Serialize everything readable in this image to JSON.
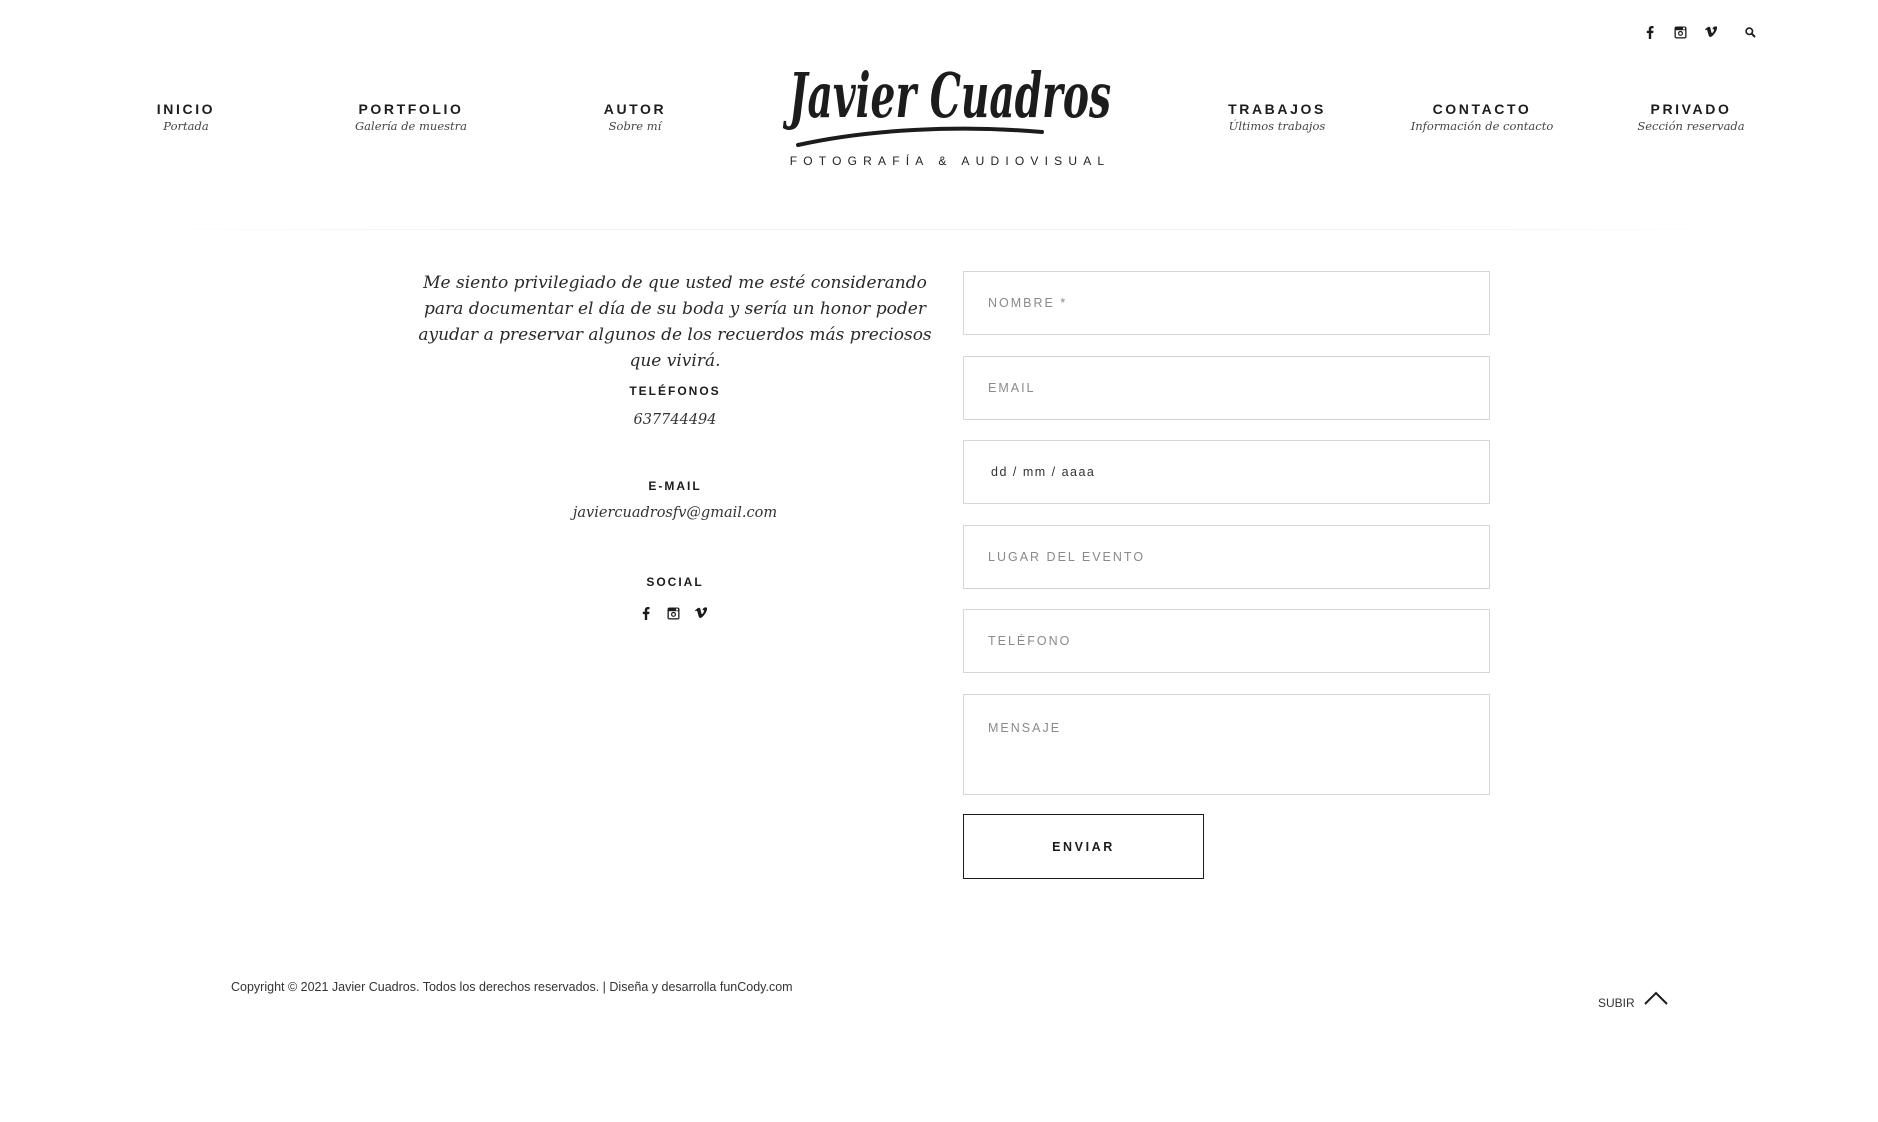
{
  "top_icons": [
    "facebook-icon",
    "instagram-icon",
    "vimeo-icon",
    "search-icon"
  ],
  "logo": {
    "script_text": "Javier Cuadros",
    "tagline": "FOTOGRAFÍA & AUDIOVISUAL"
  },
  "nav": {
    "left": [
      {
        "label": "INICIO",
        "sub": "Portada"
      },
      {
        "label": "PORTFOLIO",
        "sub": "Galería de muestra"
      },
      {
        "label": "AUTOR",
        "sub": "Sobre mí"
      }
    ],
    "right": [
      {
        "label": "TRABAJOS",
        "sub": "Últimos trabajos"
      },
      {
        "label": "CONTACTO",
        "sub": "Información de contacto"
      },
      {
        "label": "PRIVADO",
        "sub": "Sección reservada"
      }
    ]
  },
  "contact_info": {
    "intro": "Me siento privilegiado de que usted me esté considerando para documentar el día de su boda y sería un honor poder ayudar a preservar algunos de los recuerdos más preciosos que vivirá.",
    "phones_title": "TELÉFONOS",
    "phone": "637744494",
    "email_title": "E-MAIL",
    "email": "javiercuadrosfv@gmail.com",
    "social_title": "SOCIAL",
    "social_icons": [
      "facebook-icon",
      "instagram-icon",
      "vimeo-icon"
    ]
  },
  "form": {
    "name_placeholder": "NOMBRE *",
    "email_placeholder": "EMAIL",
    "date_placeholder": "dd / mm / aaaa",
    "place_placeholder": "LUGAR DEL EVENTO",
    "phone_placeholder": "TELÉFONO",
    "message_placeholder": "MENSAJE",
    "submit_label": "ENVIAR"
  },
  "footer": {
    "copyright": "Copyright © 2021 Javier Cuadros. Todos los derechos reservados. | Diseña y desarrolla funCody.com",
    "back_to_top": "SUBIR"
  },
  "colors": {
    "text": "#1c1c1c",
    "border": "#d6d6d6",
    "background": "#ffffff"
  }
}
